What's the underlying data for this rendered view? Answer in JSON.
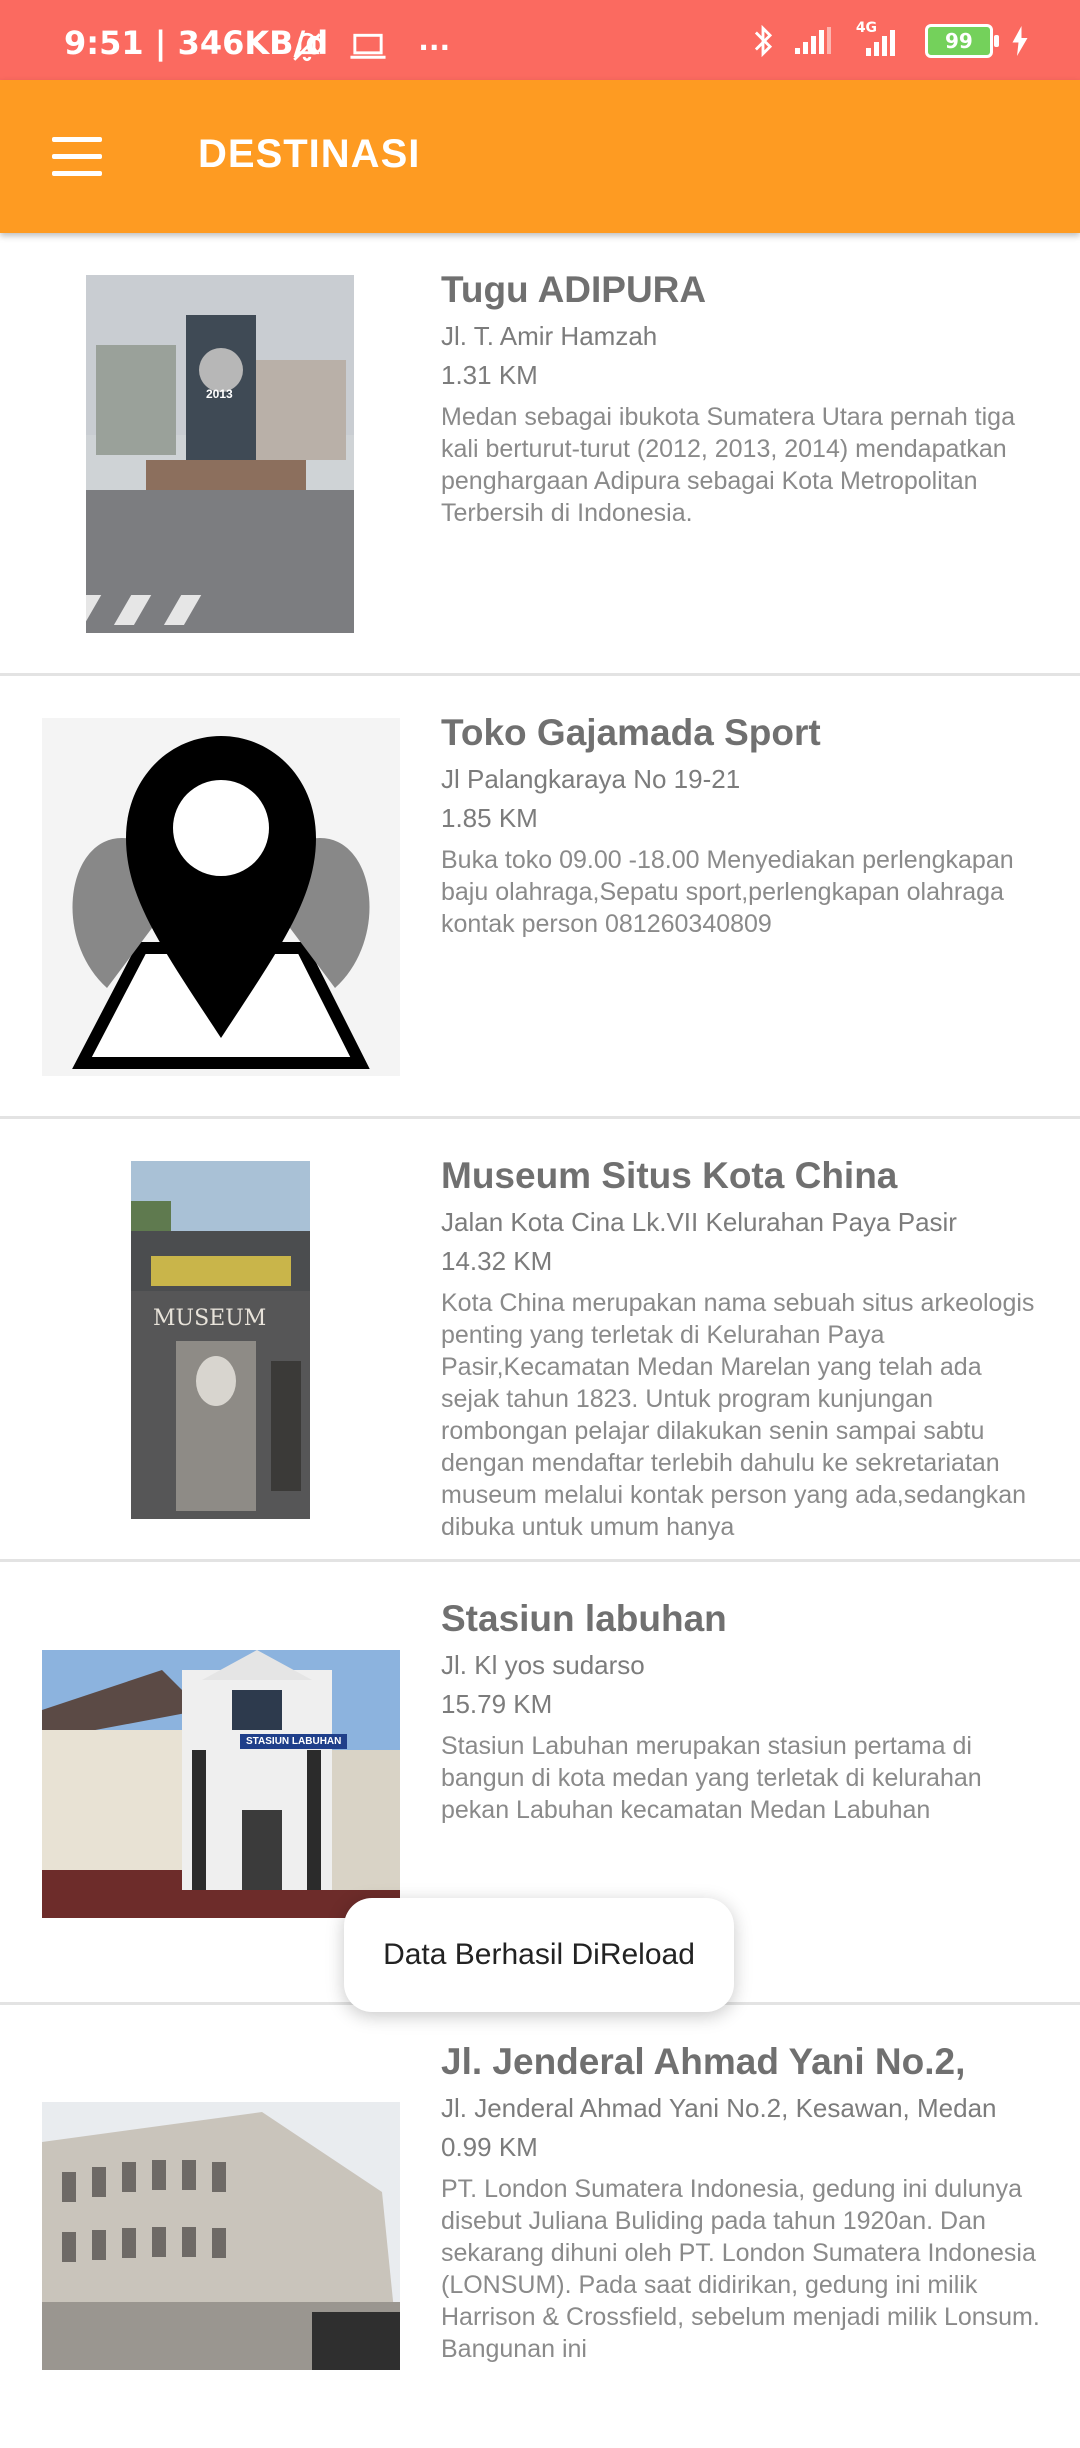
{
  "status_bar": {
    "time": "9:51",
    "speed": "346KB/d",
    "more": "···",
    "network": "4G",
    "battery": "99"
  },
  "app_bar": {
    "menu_icon": "hamburger-menu-icon",
    "title": "DESTINASI"
  },
  "destinations": [
    {
      "name": "Tugu ADIPURA",
      "address": "Jl. T. Amir Hamzah",
      "distance": "1.31 KM",
      "description": "Medan sebagai ibukota Sumatera Utara pernah tiga kali berturut-turut (2012, 2013, 2014) mendapatkan penghargaan Adipura sebagai Kota Metropolitan Terbersih di Indonesia.",
      "photo_text": "2013"
    },
    {
      "name": "Toko Gajamada Sport",
      "address": "Jl Palangkaraya No 19-21",
      "distance": "1.85 KM",
      "description": "Buka toko 09.00 -18.00 Menyediakan perlengkapan baju olahraga,Sepatu sport,perlengkapan olahraga kontak person 081260340809"
    },
    {
      "name": "Museum Situs Kota China",
      "address": "Jalan Kota Cina Lk.VII Kelurahan Paya Pasir",
      "distance": "14.32 KM",
      "description": "Kota China merupakan nama sebuah situs arkeologis penting yang terletak di Kelurahan Paya Pasir,Kecamatan Medan Marelan yang telah ada sejak tahun 1823. Untuk program kunjungan rombongan pelajar dilakukan senin sampai sabtu dengan mendaftar terlebih dahulu ke sekretariatan museum melalui kontak person yang ada,sedangkan dibuka untuk umum hanya",
      "photo_text": "MUSEUM"
    },
    {
      "name": "Stasiun labuhan",
      "address": "Jl. Kl yos sudarso",
      "distance": "15.79 KM",
      "description": "Stasiun Labuhan merupakan stasiun pertama di bangun di kota medan yang terletak di kelurahan pekan Labuhan kecamatan Medan Labuhan",
      "photo_text": "STASIUN LABUHAN"
    },
    {
      "name": "Jl. Jenderal Ahmad Yani No.2,",
      "address": "Jl. Jenderal Ahmad Yani No.2, Kesawan, Medan",
      "distance": "0.99 KM",
      "description": "PT. London Sumatera Indonesia, gedung ini dulunya disebut Juliana Buliding pada tahun 1920an. Dan sekarang dihuni oleh PT. London Sumatera Indonesia (LONSUM). Pada saat didirikan, gedung ini milik Harrison & Crossfield, sebelum menjadi milik Lonsum. Bangunan ini"
    }
  ],
  "toast": {
    "message": "Data Berhasil DiReload"
  },
  "colors": {
    "status_bar": "#fb6a60",
    "app_bar": "#fe9b22",
    "battery": "#74d15b"
  }
}
